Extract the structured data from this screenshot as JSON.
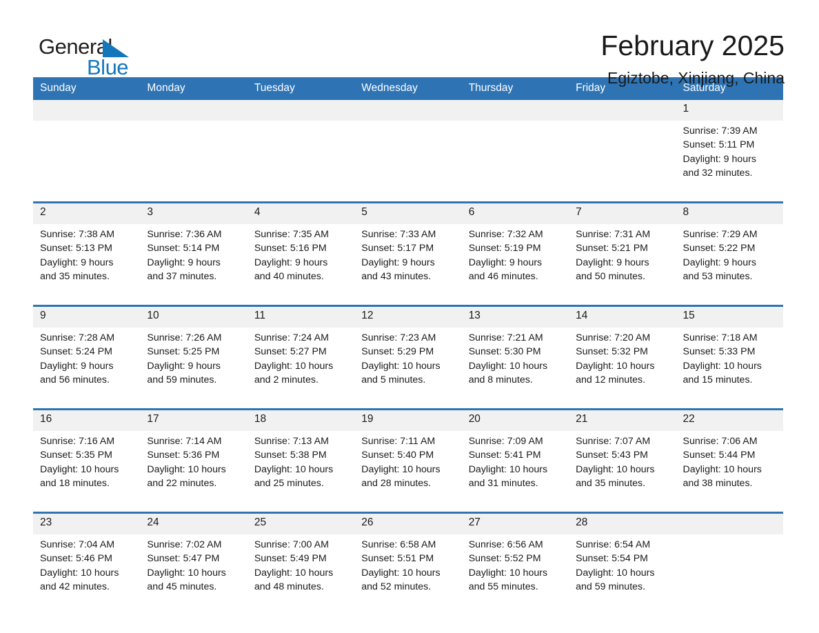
{
  "logo": {
    "word_one": "General",
    "word_two": "Blue",
    "triangle_icon": "triangle-icon",
    "accent_color": "#1477bc"
  },
  "header": {
    "title": "February 2025",
    "subtitle": "Egiztobe, Xinjiang, China"
  },
  "theme": {
    "header_blue": "#2e74b5",
    "daynum_background": "#f1f1f1",
    "text_color": "#1a1a1a"
  },
  "calendar": {
    "weekday_headers": [
      "Sunday",
      "Monday",
      "Tuesday",
      "Wednesday",
      "Thursday",
      "Friday",
      "Saturday"
    ],
    "weeks": [
      {
        "days": [
          {
            "num": "",
            "sunrise": "",
            "sunset": "",
            "daylight_1": "",
            "daylight_2": "",
            "empty": true
          },
          {
            "num": "",
            "sunrise": "",
            "sunset": "",
            "daylight_1": "",
            "daylight_2": "",
            "empty": true
          },
          {
            "num": "",
            "sunrise": "",
            "sunset": "",
            "daylight_1": "",
            "daylight_2": "",
            "empty": true
          },
          {
            "num": "",
            "sunrise": "",
            "sunset": "",
            "daylight_1": "",
            "daylight_2": "",
            "empty": true
          },
          {
            "num": "",
            "sunrise": "",
            "sunset": "",
            "daylight_1": "",
            "daylight_2": "",
            "empty": true
          },
          {
            "num": "",
            "sunrise": "",
            "sunset": "",
            "daylight_1": "",
            "daylight_2": "",
            "empty": true
          },
          {
            "num": "1",
            "sunrise": "Sunrise: 7:39 AM",
            "sunset": "Sunset: 5:11 PM",
            "daylight_1": "Daylight: 9 hours",
            "daylight_2": "and 32 minutes.",
            "empty": false
          }
        ]
      },
      {
        "days": [
          {
            "num": "2",
            "sunrise": "Sunrise: 7:38 AM",
            "sunset": "Sunset: 5:13 PM",
            "daylight_1": "Daylight: 9 hours",
            "daylight_2": "and 35 minutes.",
            "empty": false
          },
          {
            "num": "3",
            "sunrise": "Sunrise: 7:36 AM",
            "sunset": "Sunset: 5:14 PM",
            "daylight_1": "Daylight: 9 hours",
            "daylight_2": "and 37 minutes.",
            "empty": false
          },
          {
            "num": "4",
            "sunrise": "Sunrise: 7:35 AM",
            "sunset": "Sunset: 5:16 PM",
            "daylight_1": "Daylight: 9 hours",
            "daylight_2": "and 40 minutes.",
            "empty": false
          },
          {
            "num": "5",
            "sunrise": "Sunrise: 7:33 AM",
            "sunset": "Sunset: 5:17 PM",
            "daylight_1": "Daylight: 9 hours",
            "daylight_2": "and 43 minutes.",
            "empty": false
          },
          {
            "num": "6",
            "sunrise": "Sunrise: 7:32 AM",
            "sunset": "Sunset: 5:19 PM",
            "daylight_1": "Daylight: 9 hours",
            "daylight_2": "and 46 minutes.",
            "empty": false
          },
          {
            "num": "7",
            "sunrise": "Sunrise: 7:31 AM",
            "sunset": "Sunset: 5:21 PM",
            "daylight_1": "Daylight: 9 hours",
            "daylight_2": "and 50 minutes.",
            "empty": false
          },
          {
            "num": "8",
            "sunrise": "Sunrise: 7:29 AM",
            "sunset": "Sunset: 5:22 PM",
            "daylight_1": "Daylight: 9 hours",
            "daylight_2": "and 53 minutes.",
            "empty": false
          }
        ]
      },
      {
        "days": [
          {
            "num": "9",
            "sunrise": "Sunrise: 7:28 AM",
            "sunset": "Sunset: 5:24 PM",
            "daylight_1": "Daylight: 9 hours",
            "daylight_2": "and 56 minutes.",
            "empty": false
          },
          {
            "num": "10",
            "sunrise": "Sunrise: 7:26 AM",
            "sunset": "Sunset: 5:25 PM",
            "daylight_1": "Daylight: 9 hours",
            "daylight_2": "and 59 minutes.",
            "empty": false
          },
          {
            "num": "11",
            "sunrise": "Sunrise: 7:24 AM",
            "sunset": "Sunset: 5:27 PM",
            "daylight_1": "Daylight: 10 hours",
            "daylight_2": "and 2 minutes.",
            "empty": false
          },
          {
            "num": "12",
            "sunrise": "Sunrise: 7:23 AM",
            "sunset": "Sunset: 5:29 PM",
            "daylight_1": "Daylight: 10 hours",
            "daylight_2": "and 5 minutes.",
            "empty": false
          },
          {
            "num": "13",
            "sunrise": "Sunrise: 7:21 AM",
            "sunset": "Sunset: 5:30 PM",
            "daylight_1": "Daylight: 10 hours",
            "daylight_2": "and 8 minutes.",
            "empty": false
          },
          {
            "num": "14",
            "sunrise": "Sunrise: 7:20 AM",
            "sunset": "Sunset: 5:32 PM",
            "daylight_1": "Daylight: 10 hours",
            "daylight_2": "and 12 minutes.",
            "empty": false
          },
          {
            "num": "15",
            "sunrise": "Sunrise: 7:18 AM",
            "sunset": "Sunset: 5:33 PM",
            "daylight_1": "Daylight: 10 hours",
            "daylight_2": "and 15 minutes.",
            "empty": false
          }
        ]
      },
      {
        "days": [
          {
            "num": "16",
            "sunrise": "Sunrise: 7:16 AM",
            "sunset": "Sunset: 5:35 PM",
            "daylight_1": "Daylight: 10 hours",
            "daylight_2": "and 18 minutes.",
            "empty": false
          },
          {
            "num": "17",
            "sunrise": "Sunrise: 7:14 AM",
            "sunset": "Sunset: 5:36 PM",
            "daylight_1": "Daylight: 10 hours",
            "daylight_2": "and 22 minutes.",
            "empty": false
          },
          {
            "num": "18",
            "sunrise": "Sunrise: 7:13 AM",
            "sunset": "Sunset: 5:38 PM",
            "daylight_1": "Daylight: 10 hours",
            "daylight_2": "and 25 minutes.",
            "empty": false
          },
          {
            "num": "19",
            "sunrise": "Sunrise: 7:11 AM",
            "sunset": "Sunset: 5:40 PM",
            "daylight_1": "Daylight: 10 hours",
            "daylight_2": "and 28 minutes.",
            "empty": false
          },
          {
            "num": "20",
            "sunrise": "Sunrise: 7:09 AM",
            "sunset": "Sunset: 5:41 PM",
            "daylight_1": "Daylight: 10 hours",
            "daylight_2": "and 31 minutes.",
            "empty": false
          },
          {
            "num": "21",
            "sunrise": "Sunrise: 7:07 AM",
            "sunset": "Sunset: 5:43 PM",
            "daylight_1": "Daylight: 10 hours",
            "daylight_2": "and 35 minutes.",
            "empty": false
          },
          {
            "num": "22",
            "sunrise": "Sunrise: 7:06 AM",
            "sunset": "Sunset: 5:44 PM",
            "daylight_1": "Daylight: 10 hours",
            "daylight_2": "and 38 minutes.",
            "empty": false
          }
        ]
      },
      {
        "days": [
          {
            "num": "23",
            "sunrise": "Sunrise: 7:04 AM",
            "sunset": "Sunset: 5:46 PM",
            "daylight_1": "Daylight: 10 hours",
            "daylight_2": "and 42 minutes.",
            "empty": false
          },
          {
            "num": "24",
            "sunrise": "Sunrise: 7:02 AM",
            "sunset": "Sunset: 5:47 PM",
            "daylight_1": "Daylight: 10 hours",
            "daylight_2": "and 45 minutes.",
            "empty": false
          },
          {
            "num": "25",
            "sunrise": "Sunrise: 7:00 AM",
            "sunset": "Sunset: 5:49 PM",
            "daylight_1": "Daylight: 10 hours",
            "daylight_2": "and 48 minutes.",
            "empty": false
          },
          {
            "num": "26",
            "sunrise": "Sunrise: 6:58 AM",
            "sunset": "Sunset: 5:51 PM",
            "daylight_1": "Daylight: 10 hours",
            "daylight_2": "and 52 minutes.",
            "empty": false
          },
          {
            "num": "27",
            "sunrise": "Sunrise: 6:56 AM",
            "sunset": "Sunset: 5:52 PM",
            "daylight_1": "Daylight: 10 hours",
            "daylight_2": "and 55 minutes.",
            "empty": false
          },
          {
            "num": "28",
            "sunrise": "Sunrise: 6:54 AM",
            "sunset": "Sunset: 5:54 PM",
            "daylight_1": "Daylight: 10 hours",
            "daylight_2": "and 59 minutes.",
            "empty": false
          },
          {
            "num": "",
            "sunrise": "",
            "sunset": "",
            "daylight_1": "",
            "daylight_2": "",
            "empty": true
          }
        ]
      }
    ]
  }
}
